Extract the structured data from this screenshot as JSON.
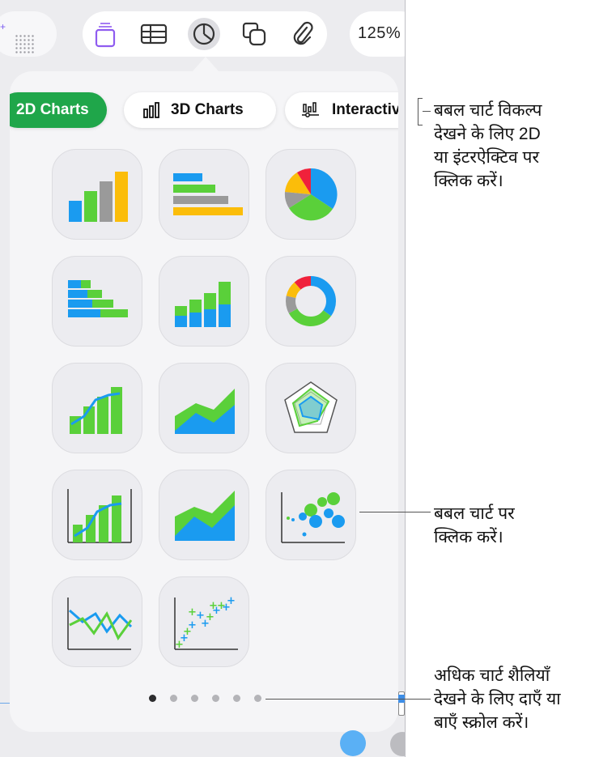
{
  "toolbar": {
    "zoom": "125%",
    "tools": [
      {
        "name": "text-icon"
      },
      {
        "name": "table-icon"
      },
      {
        "name": "chart-icon",
        "active": true
      },
      {
        "name": "shape-icon"
      },
      {
        "name": "media-icon"
      }
    ]
  },
  "chart_panel": {
    "tabs": [
      {
        "label": "2D Charts",
        "selected": true
      },
      {
        "label": "3D Charts",
        "selected": false
      },
      {
        "label": "Interactive",
        "selected": false
      }
    ],
    "chart_types": [
      "column-chart-icon",
      "bar-chart-icon",
      "pie-chart-icon",
      "stacked-bar-chart-icon",
      "stacked-column-chart-icon",
      "donut-chart-icon",
      "mixed-chart-icon",
      "area-chart-icon",
      "radar-chart-icon",
      "two-axis-chart-icon",
      "stacked-area-chart-icon",
      "bubble-chart-icon",
      "line-chart-icon",
      "scatter-chart-icon"
    ],
    "page_count": 6,
    "current_page": 1
  },
  "colors": {
    "accent_green": "#1fa64a",
    "chart_blue": "#1a9bf0",
    "chart_green": "#5ad03a",
    "chart_yellow": "#fbbd0a",
    "chart_red": "#f0213b",
    "chart_gray": "#9a9a9a"
  },
  "callouts": {
    "tabs_line1": "बबल चार्ट विकल्प",
    "tabs_line2": "देखने के लिए 2D",
    "tabs_line3": "या इंटरऐक्टिव पर",
    "tabs_line4": "क्लिक करें।",
    "bubble_line1": "बबल चार्ट पर",
    "bubble_line2": "क्लिक करें।",
    "scroll_line1": "अधिक चार्ट शैलियाँ",
    "scroll_line2": "देखने के लिए दाएँ या",
    "scroll_line3": "बाएँ स्क्रोल करें।"
  }
}
